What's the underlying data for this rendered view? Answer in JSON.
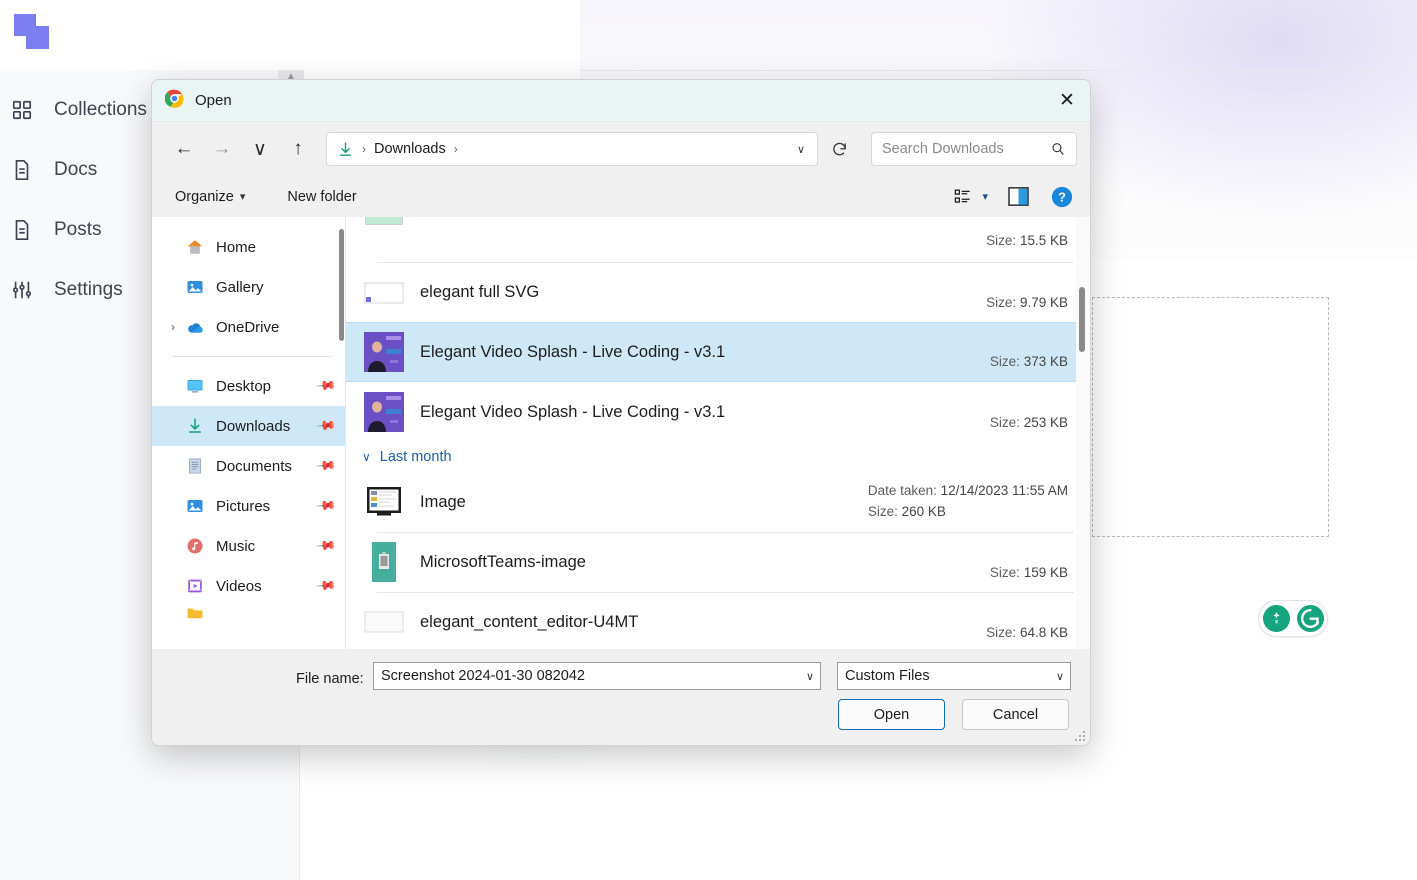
{
  "background_app": {
    "logo_color": "#7b7ef0",
    "nav": [
      {
        "label": "Collections",
        "icon": "grid-icon"
      },
      {
        "label": "Docs",
        "icon": "document-icon"
      },
      {
        "label": "Posts",
        "icon": "document-icon"
      },
      {
        "label": "Settings",
        "icon": "sliders-icon"
      }
    ],
    "grammarly": {
      "lightbulb": "lightbulb-icon",
      "logo": "G"
    }
  },
  "dialog": {
    "title": "Open",
    "app_icon": "chrome-icon",
    "close_label": "✕",
    "nav": {
      "back": "←",
      "forward": "→",
      "recent": "∨",
      "up": "↑",
      "refresh": "↻"
    },
    "address": {
      "icon": "downloads-arrow-icon",
      "crumbs": [
        "Downloads"
      ],
      "separator": "›",
      "dropdown": "∨"
    },
    "search": {
      "placeholder": "Search Downloads",
      "icon": "search-icon"
    },
    "commands": {
      "organize": "Organize",
      "organize_caret": "▾",
      "new_folder": "New folder",
      "view_icon": "view-options-icon",
      "view_caret": "▾",
      "preview_icon": "preview-pane-icon",
      "help_icon": "help-icon",
      "help_glyph": "?"
    },
    "tree": {
      "top": [
        {
          "label": "Home",
          "icon": "home-icon",
          "expandable": false,
          "pinned": false
        },
        {
          "label": "Gallery",
          "icon": "gallery-icon",
          "expandable": false,
          "pinned": false
        },
        {
          "label": "OneDrive",
          "icon": "onedrive-icon",
          "expandable": true,
          "pinned": false
        }
      ],
      "quick_access": [
        {
          "label": "Desktop",
          "icon": "desktop-icon",
          "pinned": true,
          "selected": false
        },
        {
          "label": "Downloads",
          "icon": "downloads-arrow-icon",
          "pinned": true,
          "selected": true
        },
        {
          "label": "Documents",
          "icon": "documents-icon",
          "pinned": true,
          "selected": false
        },
        {
          "label": "Pictures",
          "icon": "pictures-icon",
          "pinned": true,
          "selected": false
        },
        {
          "label": "Music",
          "icon": "music-icon",
          "pinned": true,
          "selected": false
        },
        {
          "label": "Videos",
          "icon": "videos-icon",
          "pinned": true,
          "selected": false
        }
      ],
      "expand_glyph": "›",
      "pin_glyph": "📌"
    },
    "file_list": [
      {
        "kind": "file",
        "name": "",
        "thumb": "green-thumb",
        "size_label": "Size:",
        "size": "15.5 KB",
        "date_label": "",
        "date": "",
        "selected": false,
        "clipped_top": true
      },
      {
        "kind": "file",
        "name": "elegant full SVG",
        "thumb": "svg-thumb",
        "size_label": "Size:",
        "size": "9.79 KB",
        "date_label": "",
        "date": "",
        "selected": false
      },
      {
        "kind": "file",
        "name": "Elegant Video Splash - Live Coding - v3.1",
        "thumb": "video-thumb",
        "size_label": "Size:",
        "size": "373 KB",
        "date_label": "",
        "date": "",
        "selected": true
      },
      {
        "kind": "file",
        "name": "Elegant Video Splash - Live Coding - v3.1",
        "thumb": "video-thumb",
        "size_label": "Size:",
        "size": "253 KB",
        "date_label": "",
        "date": "",
        "selected": false
      },
      {
        "kind": "group",
        "name": "Last month",
        "collapse_glyph": "∨"
      },
      {
        "kind": "file",
        "name": "Image",
        "thumb": "screen-thumb",
        "size_label": "Size:",
        "size": "260 KB",
        "date_label": "Date taken:",
        "date": "12/14/2023 11:55 AM",
        "selected": false
      },
      {
        "kind": "file",
        "name": "MicrosoftTeams-image",
        "thumb": "teams-thumb",
        "size_label": "Size:",
        "size": "159 KB",
        "date_label": "",
        "date": "",
        "selected": false
      },
      {
        "kind": "file",
        "name": "elegant_content_editor-U4MT",
        "thumb": "blank-thumb",
        "size_label": "Size:",
        "size": "64.8 KB",
        "date_label": "",
        "date": "",
        "selected": false
      }
    ],
    "footer": {
      "filename_label": "File name:",
      "filename_value": "Screenshot 2024-01-30 082042",
      "filetype_value": "Custom Files",
      "dropdown_glyph": "∨",
      "open_label": "Open",
      "cancel_label": "Cancel"
    }
  }
}
